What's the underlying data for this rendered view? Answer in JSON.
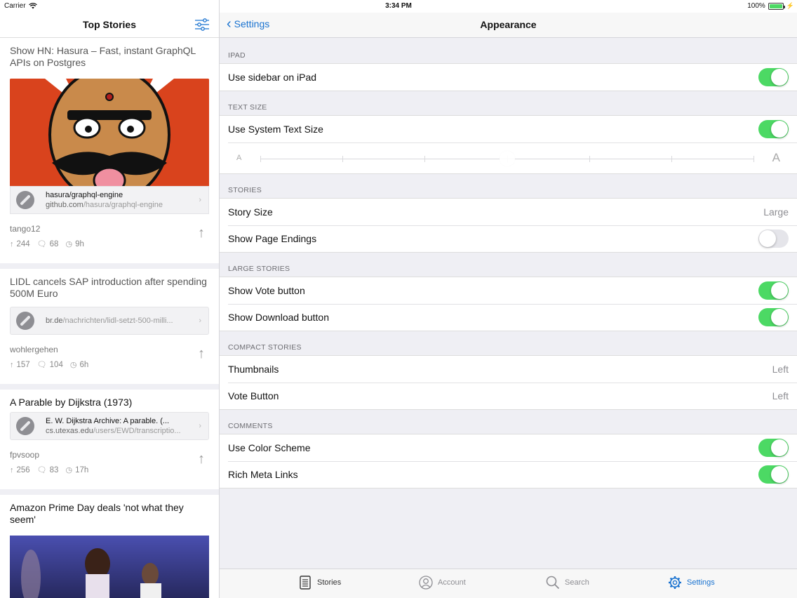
{
  "status_bar": {
    "carrier": "Carrier",
    "time": "3:34 PM",
    "battery": "100%",
    "battery_level": 1.0
  },
  "left": {
    "title": "Top Stories",
    "stories": [
      {
        "title": "Show HN: Hasura – Fast, instant GraphQL APIs on Postgres",
        "link_title": "hasura/graphql-engine",
        "link_domain": "github.com",
        "link_path": "/hasura/graphql-engine",
        "author": "tango12",
        "points": "244",
        "comments": "68",
        "age": "9h"
      },
      {
        "title": "LIDL cancels SAP introduction after spending 500M Euro",
        "link_domain": "br.de",
        "link_path": "/nachrichten/lidl-setzt-500-milli...",
        "author": "wohlergehen",
        "points": "157",
        "comments": "104",
        "age": "6h"
      },
      {
        "title": "A Parable by Dijkstra (1973)",
        "link_title": "E. W. Dijkstra Archive: A parable. (...",
        "link_domain": "cs.utexas.edu",
        "link_path": "/users/EWD/transcriptio...",
        "author": "fpvsoop",
        "points": "256",
        "comments": "83",
        "age": "17h"
      },
      {
        "title": "Amazon Prime Day deals 'not what they seem'"
      }
    ]
  },
  "right": {
    "back_label": "Settings",
    "title": "Appearance",
    "sections": {
      "ipad": {
        "header": "IPAD",
        "use_sidebar": "Use sidebar on iPad"
      },
      "text_size": {
        "header": "TEXT SIZE",
        "use_system": "Use System Text Size",
        "small_a": "A",
        "big_a": "A"
      },
      "stories": {
        "header": "STORIES",
        "story_size": "Story Size",
        "story_size_value": "Large",
        "show_page_endings": "Show Page Endings"
      },
      "large_stories": {
        "header": "LARGE STORIES",
        "show_vote": "Show Vote button",
        "show_download": "Show Download button"
      },
      "compact_stories": {
        "header": "COMPACT STORIES",
        "thumbnails": "Thumbnails",
        "thumbnails_value": "Left",
        "vote_button": "Vote Button",
        "vote_button_value": "Left"
      },
      "comments": {
        "header": "COMMENTS",
        "use_color": "Use Color Scheme",
        "rich_meta": "Rich Meta Links"
      }
    },
    "toggles": {
      "use_sidebar": true,
      "use_system_text": true,
      "show_page_endings": false,
      "show_vote": true,
      "show_download": true,
      "use_color": true,
      "rich_meta": true
    }
  },
  "tabbar": {
    "stories": "Stories",
    "account": "Account",
    "search": "Search",
    "settings": "Settings"
  },
  "colors": {
    "accent": "#1a73d0",
    "toggle_on": "#4cd964",
    "background": "#efeff4"
  }
}
